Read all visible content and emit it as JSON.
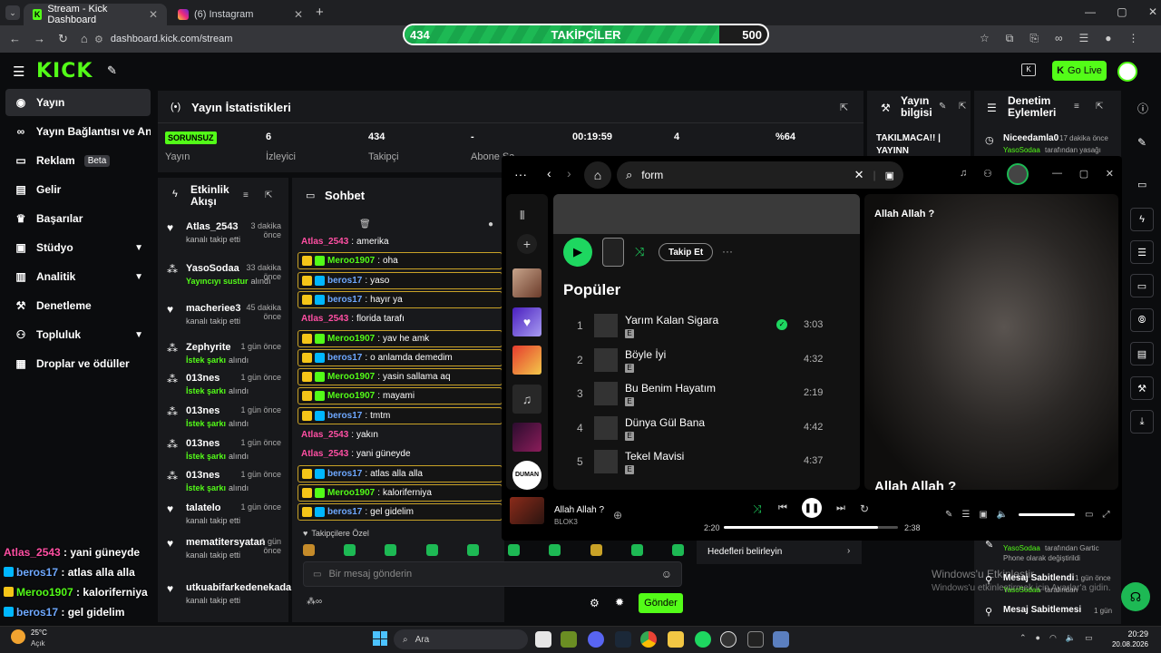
{
  "browser": {
    "tabs": [
      {
        "title": "Stream - Kick Dashboard"
      },
      {
        "title": "(6) Instagram"
      }
    ],
    "url": "dashboard.kick.com/stream"
  },
  "follower_goal": {
    "current": "434",
    "label": "TAKİPÇİLER",
    "target": "500",
    "progress": 0.868
  },
  "header": {
    "logo": "KICK",
    "go_live": "Go Live"
  },
  "sidebar": {
    "items": [
      {
        "label": "Yayın"
      },
      {
        "label": "Yayın Bağlantısı ve Anahtarı"
      },
      {
        "label": "Reklam",
        "badge": "Beta"
      },
      {
        "label": "Gelir"
      },
      {
        "label": "Başarılar"
      },
      {
        "label": "Stüdyo"
      },
      {
        "label": "Analitik"
      },
      {
        "label": "Denetleme"
      },
      {
        "label": "Topluluk"
      },
      {
        "label": "Droplar ve ödüller"
      }
    ]
  },
  "stats": {
    "title": "Yayın İstatistikleri",
    "items": [
      {
        "value": "SORUNSUZ",
        "label": "Yayın"
      },
      {
        "value": "6",
        "label": "İzleyici"
      },
      {
        "value": "434",
        "label": "Takipçi"
      },
      {
        "value": "-",
        "label": "Abone Sa"
      },
      {
        "value": "00:19:59",
        "label": ""
      },
      {
        "value": "4",
        "label": ""
      },
      {
        "value": "%64",
        "label": ""
      }
    ]
  },
  "stream_info": {
    "title": "Yayın bilgisi",
    "text1": "TAKILMACA!! |",
    "text2": "YAYINN"
  },
  "mod_actions": {
    "title": "Denetim Eylemleri",
    "first": {
      "name": "Niceedamla0",
      "time": "17 dakika önce",
      "actor": "YasoSodaa",
      "text": "tarafından yasağı"
    },
    "entries": [
      {
        "actor": "YasoSodaa",
        "text": "tarafından Gartic",
        "text2": "Phone olarak değiştirildi"
      },
      {
        "name": "Mesaj Sabitlendi",
        "time": "1 gün önce",
        "actor": "YasoSodaa",
        "text": "tarafından"
      },
      {
        "name": "Mesaj Sabitlemesi",
        "time": "1 gün"
      }
    ]
  },
  "activity": {
    "title1": "Etkinlik",
    "title2": "Akışı",
    "items": [
      {
        "name": "Atlas_2543",
        "time1": "3 dakika",
        "time2": "önce",
        "sub": "kanalı takip etti",
        "type": "follow"
      },
      {
        "name": "YasoSodaa",
        "time1": "33 dakika",
        "time2": "önce",
        "sub": "Yayıncıyı sustur",
        "sub2": "alındı",
        "type": "reward"
      },
      {
        "name": "macheriee3",
        "time1": "45 dakika",
        "time2": "önce",
        "sub": "kanalı takip etti",
        "type": "follow"
      },
      {
        "name": "Zephyrite",
        "time1": "1 gün önce",
        "time2": "",
        "sub": "İstek şarkı",
        "sub2": "alındı",
        "type": "reward"
      },
      {
        "name": "013nes",
        "time1": "1 gün önce",
        "time2": "",
        "sub": "İstek şarkı",
        "sub2": "alındı",
        "type": "reward"
      },
      {
        "name": "013nes",
        "time1": "1 gün önce",
        "time2": "",
        "sub": "İstek şarkı",
        "sub2": "alındı",
        "type": "reward"
      },
      {
        "name": "013nes",
        "time1": "1 gün önce",
        "time2": "",
        "sub": "İstek şarkı",
        "sub2": "alındı",
        "type": "reward"
      },
      {
        "name": "013nes",
        "time1": "1 gün önce",
        "time2": "",
        "sub": "İstek şarkı",
        "sub2": "alındı",
        "type": "reward"
      },
      {
        "name": "talatelo",
        "time1": "1 gün önce",
        "time2": "",
        "sub": "kanalı takip etti",
        "type": "follow"
      },
      {
        "name": "mematitersyatan",
        "time1": "1 gün",
        "time2": "önce",
        "sub": "kanalı takip etti",
        "type": "follow"
      },
      {
        "name": "utkuabifarkedenekada",
        "time1": "",
        "time2": "",
        "sub": "kanalı takip etti",
        "type": "follow"
      }
    ]
  },
  "chat": {
    "title": "Sohbet",
    "messages": [
      {
        "user": "Atlas_2543",
        "text": "amerika",
        "color": "#ff4fa3",
        "boxed": false
      },
      {
        "user": "Meroo1907",
        "text": "oha",
        "color": "#53fc18",
        "boxed": true
      },
      {
        "user": "beros17",
        "text": "yaso",
        "color": "#6ea8ff",
        "boxed": true
      },
      {
        "user": "beros17",
        "text": "hayır ya",
        "color": "#6ea8ff",
        "boxed": true
      },
      {
        "user": "Atlas_2543",
        "text": "florida tarafı",
        "color": "#ff4fa3",
        "boxed": false
      },
      {
        "user": "Meroo1907",
        "text": "yav he amk",
        "color": "#53fc18",
        "boxed": true
      },
      {
        "user": "beros17",
        "text": "o anlamda demedim",
        "color": "#6ea8ff",
        "boxed": true
      },
      {
        "user": "Meroo1907",
        "text": "yasin sallama aq",
        "color": "#53fc18",
        "boxed": true
      },
      {
        "user": "Meroo1907",
        "text": "mayami",
        "color": "#53fc18",
        "boxed": true
      },
      {
        "user": "beros17",
        "text": "tmtm",
        "color": "#6ea8ff",
        "boxed": true
      },
      {
        "user": "Atlas_2543",
        "text": "yakın",
        "color": "#ff4fa3",
        "boxed": false
      },
      {
        "user": "Atlas_2543",
        "text": "yani güneyde",
        "color": "#ff4fa3",
        "boxed": false
      },
      {
        "user": "beros17",
        "text": "atlas alla alla",
        "color": "#6ea8ff",
        "boxed": true
      },
      {
        "user": "Meroo1907",
        "text": "kaloriferniya",
        "color": "#53fc18",
        "boxed": true
      },
      {
        "user": "beros17",
        "text": "gel gidelim",
        "color": "#6ea8ff",
        "boxed": true
      }
    ],
    "followers_only": "Takipçilere Özel",
    "placeholder": "Bir mesaj gönderin",
    "send": "Gönder"
  },
  "goals": {
    "label": "Hedefleri belirleyin"
  },
  "spotify": {
    "search": "form",
    "follow": "Takip Et",
    "section": "Popüler",
    "tracks": [
      {
        "n": "1",
        "name": "Yarım Kalan Sigara",
        "dur": "3:03"
      },
      {
        "n": "2",
        "name": "Böyle İyi",
        "dur": "4:32"
      },
      {
        "n": "3",
        "name": "Bu Benim Hayatım",
        "dur": "2:19"
      },
      {
        "n": "4",
        "name": "Dünya Gül Bana",
        "dur": "4:42"
      },
      {
        "n": "5",
        "name": "Tekel Mavisi",
        "dur": "4:37"
      }
    ],
    "explicit": "E",
    "now_playing": {
      "title": "Allah Allah ?",
      "artist": "BLOK3",
      "elapsed": "2:20",
      "total": "2:38",
      "progress": 0.886
    },
    "side_title": "Allah Allah ?",
    "side_big": "Allah Allah ?",
    "library_label": "DUMAN"
  },
  "overlay": [
    {
      "user": "Atlas_2543",
      "text": " : yani güneyde",
      "color": "#ff4fa3"
    },
    {
      "user": "beros17",
      "text": " : atlas alla alla",
      "color": "#6ea8ff"
    },
    {
      "user": "Meroo1907",
      "text": " : kaloriferniya",
      "color": "#53fc18"
    },
    {
      "user": "beros17",
      "text": " : gel gidelim",
      "color": "#6ea8ff"
    }
  ],
  "watermark": {
    "line1": "Windows'u Etkinleştir",
    "line2": "Windows'u etkinleştirmek için Ayarlar'a gidin."
  },
  "taskbar": {
    "weather_temp": "25°C",
    "weather_desc": "Açık",
    "search": "Ara",
    "time": "20:29",
    "date": "20.08.2026"
  }
}
